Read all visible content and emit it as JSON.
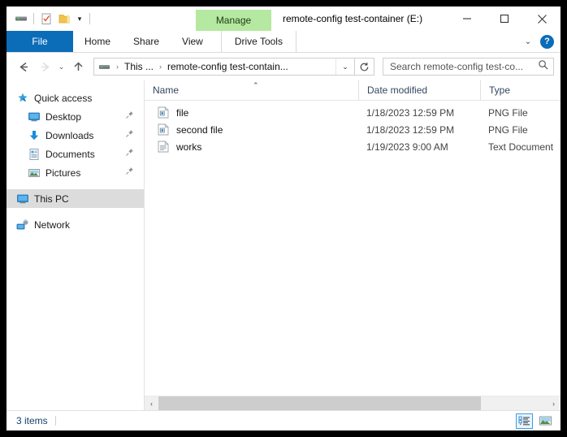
{
  "window": {
    "title": "remote-config test-container (E:)",
    "controls": {
      "minimize": "minimize-icon",
      "maximize": "maximize-icon",
      "close": "close-icon"
    }
  },
  "quick_access_toolbar": {
    "items": [
      {
        "name": "drive-icon",
        "label": ""
      },
      {
        "name": "properties-icon",
        "label": ""
      },
      {
        "name": "new-folder-icon",
        "label": ""
      },
      {
        "name": "customize-chevron-icon",
        "label": "▾"
      }
    ]
  },
  "ribbon": {
    "contextual_header": "Manage",
    "tabs": [
      {
        "label": "File",
        "id": "file",
        "active": false
      },
      {
        "label": "Home",
        "id": "home",
        "active": false
      },
      {
        "label": "Share",
        "id": "share",
        "active": false
      },
      {
        "label": "View",
        "id": "view",
        "active": false
      },
      {
        "label": "Drive Tools",
        "id": "drive-tools",
        "active": true
      }
    ],
    "collapse_icon": "⌄",
    "help_label": "?"
  },
  "navigation": {
    "back": "←",
    "forward": "→",
    "recent_chevron": "⌄",
    "up": "↑",
    "refresh_icon": "↻",
    "breadcrumb": {
      "drive_icon": "drive-icon",
      "segments": [
        "This ...",
        "remote-config test-contain..."
      ],
      "separator": "›",
      "dropdown_icon": "⌄"
    }
  },
  "search": {
    "placeholder": "Search remote-config test-co...",
    "value": "",
    "icon": "search-icon"
  },
  "sidebar": {
    "items": [
      {
        "label": "Quick access",
        "icon": "quick-access-star-icon",
        "level": "root",
        "pinned": false,
        "selected": false
      },
      {
        "label": "Desktop",
        "icon": "desktop-icon",
        "level": "child",
        "pinned": true,
        "selected": false
      },
      {
        "label": "Downloads",
        "icon": "downloads-arrow-icon",
        "level": "child",
        "pinned": true,
        "selected": false
      },
      {
        "label": "Documents",
        "icon": "documents-icon",
        "level": "child",
        "pinned": true,
        "selected": false
      },
      {
        "label": "Pictures",
        "icon": "pictures-icon",
        "level": "child",
        "pinned": true,
        "selected": false
      },
      {
        "label": "This PC",
        "icon": "this-pc-icon",
        "level": "root",
        "pinned": false,
        "selected": true
      },
      {
        "label": "Network",
        "icon": "network-icon",
        "level": "root",
        "pinned": false,
        "selected": false
      }
    ]
  },
  "file_list": {
    "columns": [
      {
        "label": "Name",
        "sorted": "asc",
        "sort_caret": "⌃"
      },
      {
        "label": "Date modified",
        "sorted": "none"
      },
      {
        "label": "Type",
        "sorted": "none"
      }
    ],
    "rows": [
      {
        "name": "file",
        "date_modified": "1/18/2023 12:59 PM",
        "type": "PNG File",
        "icon": "png-file-icon"
      },
      {
        "name": "second file",
        "date_modified": "1/18/2023 12:59 PM",
        "type": "PNG File",
        "icon": "png-file-icon"
      },
      {
        "name": "works",
        "date_modified": "1/19/2023 9:00 AM",
        "type": "Text Document",
        "icon": "text-document-icon"
      }
    ],
    "scrollbar": {
      "left_arrow": "‹",
      "right_arrow": "›"
    }
  },
  "status_bar": {
    "item_count": "3 items",
    "views": [
      {
        "name": "details-view-button",
        "active": true
      },
      {
        "name": "large-icons-view-button",
        "active": false
      }
    ]
  },
  "colors": {
    "file_tab_blue": "#0b6cb8",
    "manage_green": "#b5e8a0",
    "selection_gray": "#dcdcdc",
    "status_text_blue": "#16406b",
    "view_active_border": "#3aa0dd"
  }
}
